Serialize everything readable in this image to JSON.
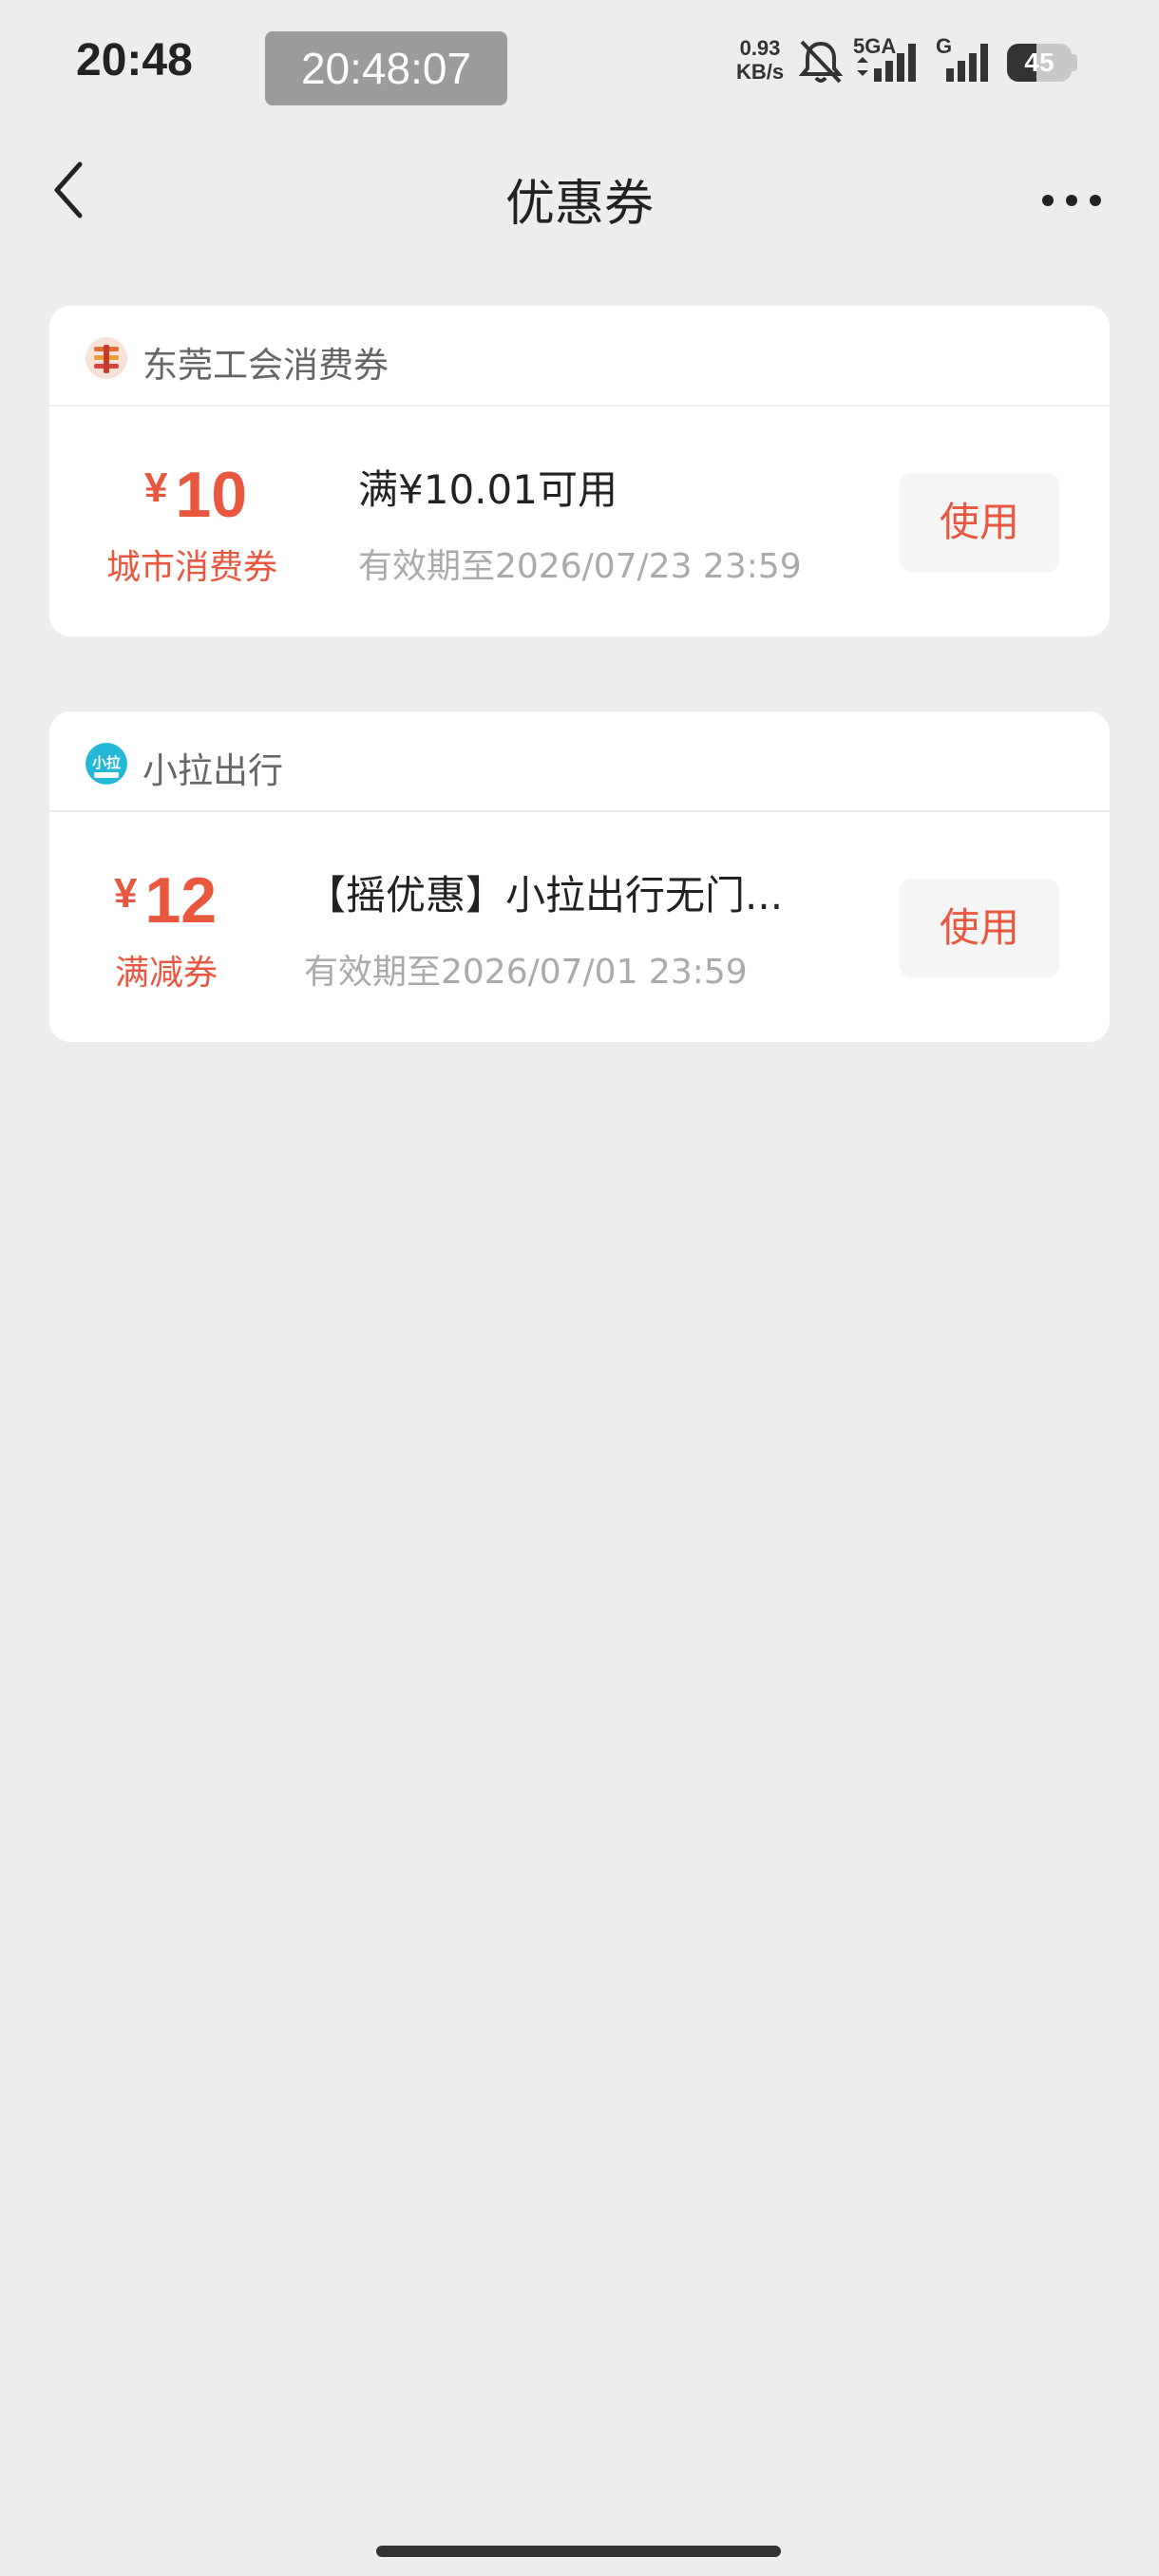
{
  "status_bar": {
    "time": "20:48",
    "clock_overlay": "20:48:07",
    "net_speed_value": "0.93",
    "net_speed_unit": "KB/s",
    "network_5g_label": "5GA",
    "network_g_label": "G",
    "battery_percent": 45,
    "battery_label": "45",
    "icons": [
      "mute-bell-icon",
      "signal-5g-icon",
      "signal-g-icon",
      "battery-icon"
    ]
  },
  "nav": {
    "title": "优惠券",
    "back_icon": "chevron-left-icon",
    "more_icon": "more-dots-icon"
  },
  "coupons": [
    {
      "brand_name": "东莞工会消费券",
      "brand_icon": "dongguan-union-logo",
      "currency": "¥",
      "amount": "10",
      "kind": "城市消费券",
      "title": "满¥10.01可用",
      "expiry": "有效期至2026/07/23 23:59",
      "button_label": "使用"
    },
    {
      "brand_name": "小拉出行",
      "brand_icon": "xiaola-logo",
      "brand_icon_text": "小拉",
      "currency": "¥",
      "amount": "12",
      "kind": "满减券",
      "title": "【摇优惠】小拉出行无门...",
      "expiry": "有效期至2026/07/01 23:59",
      "button_label": "使用"
    }
  ],
  "colors": {
    "accent": "#e9573f",
    "background": "#ededed",
    "card": "#ffffff",
    "muted_text": "#aaaaaa",
    "xiaola_brand": "#22b8d6"
  }
}
